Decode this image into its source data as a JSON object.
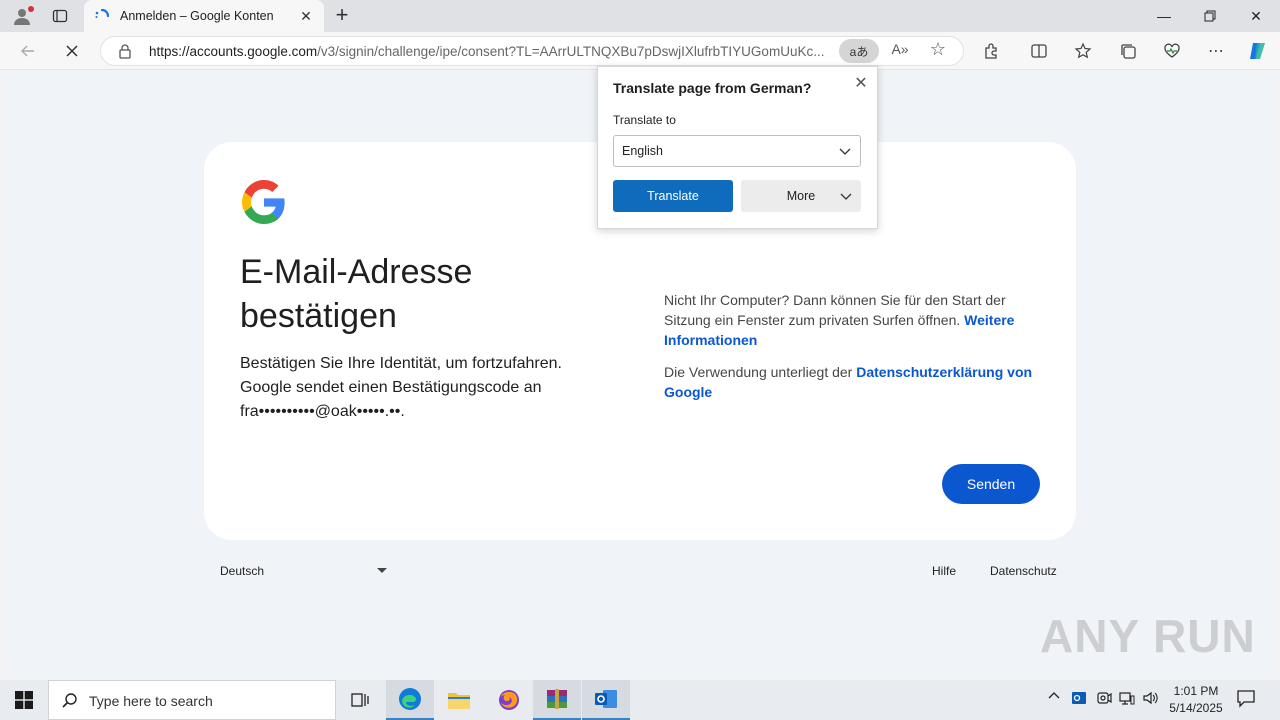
{
  "browser": {
    "tab_title": "Anmelden – Google Konten",
    "url_host": "https://accounts.google.com",
    "url_path": "/v3/signin/challenge/ipe/consent?TL=AArrULTNQXBu7pDswjIXlufrbTIYUGomUuKc...",
    "translate_icon_text": "aあ"
  },
  "translate_popup": {
    "title": "Translate page from German?",
    "label": "Translate to",
    "selected_language": "English",
    "translate_button": "Translate",
    "more_button": "More"
  },
  "page": {
    "heading": "E-Mail-Adresse bestätigen",
    "description": "Bestätigen Sie Ihre Identität, um fortzufahren. Google sendet einen Bestätigungscode an fra••••••••••@oak•••••.••.",
    "info_text": "Nicht Ihr Computer? Dann können Sie für den Start der Sitzung ein Fenster zum privaten Surfen öffnen.",
    "info_link": "Weitere Informationen",
    "privacy_text": "Die Verwendung unterliegt der",
    "privacy_link": "Datenschutzerklärung von Google",
    "submit_button": "Senden"
  },
  "footer": {
    "language": "Deutsch",
    "help": "Hilfe",
    "privacy": "Datenschutz"
  },
  "watermark": "ANY RUN",
  "taskbar": {
    "search_placeholder": "Type here to search",
    "time": "1:01 PM",
    "date": "5/14/2025"
  },
  "colors": {
    "google_blue": "#0b57d0",
    "edge_translate_blue": "#0f6cbd"
  }
}
